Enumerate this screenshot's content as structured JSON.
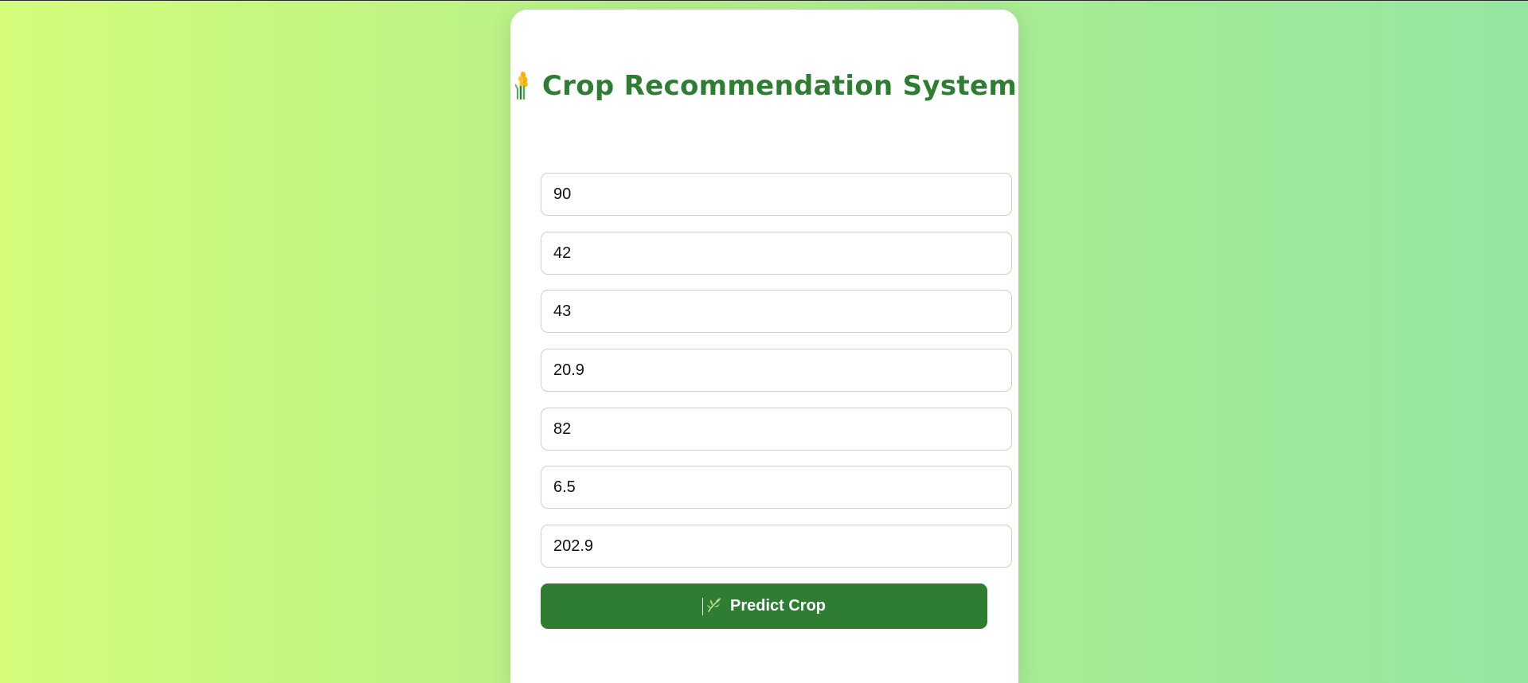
{
  "header": {
    "title": "Crop Recommendation System",
    "icon": "wheat-icon"
  },
  "form": {
    "fields": [
      {
        "value": "90"
      },
      {
        "value": "42"
      },
      {
        "value": "43"
      },
      {
        "value": "20.9"
      },
      {
        "value": "82"
      },
      {
        "value": "6.5"
      },
      {
        "value": "202.9"
      }
    ],
    "submit": {
      "label": "Predict Crop",
      "icon": "seedling-icon"
    }
  },
  "colors": {
    "brand_green": "#2e7d32",
    "gradient_start": "#d4fc79",
    "gradient_end": "#96e6a1",
    "card_background": "#ffffff"
  }
}
